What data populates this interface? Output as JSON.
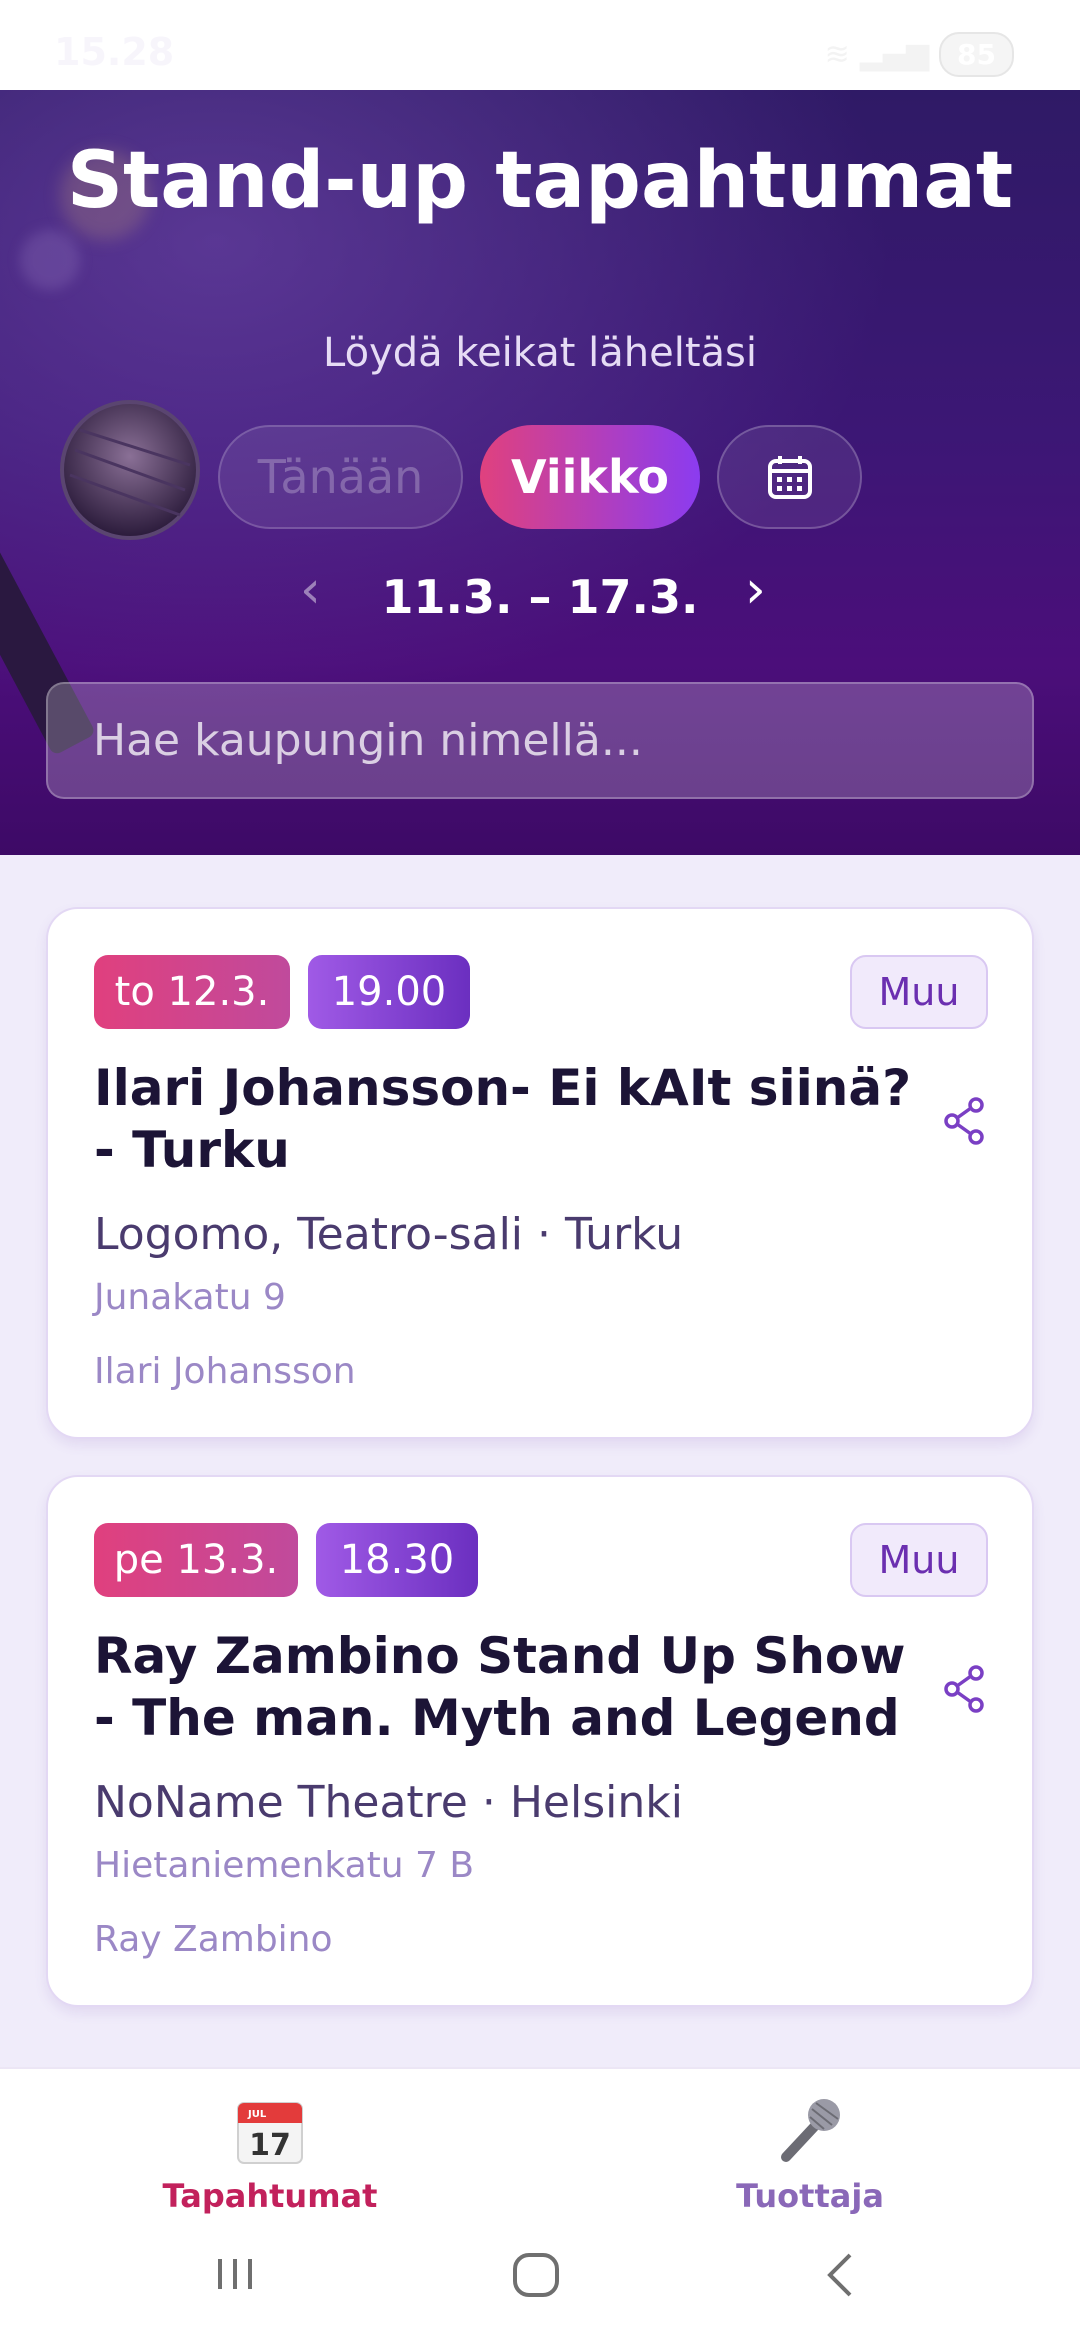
{
  "status_bar": {
    "time": "15.28",
    "battery": "85"
  },
  "hero": {
    "title": "Stand-up tapahtumat",
    "subtitle": "Löydä keikat läheltäsi",
    "segments": {
      "today": "Tänään",
      "week": "Viikko"
    },
    "date_range": "11.3. – 17.3.",
    "search_placeholder": "Hae kaupungin nimellä..."
  },
  "events": [
    {
      "date": "to 12.3.",
      "time": "19.00",
      "category": "Muu",
      "title": "Ilari Johansson- Ei kAIt siinä? - Turku",
      "venue": "Logomo, Teatro-sali · Turku",
      "address": "Junakatu 9",
      "performer": "Ilari Johansson"
    },
    {
      "date": "pe 13.3.",
      "time": "18.30",
      "category": "Muu",
      "title": "Ray Zambino Stand Up Show - The man. Myth and Legend",
      "venue": "NoName Theatre · Helsinki",
      "address": "Hietaniemenkatu 7 B",
      "performer": "Ray Zambino"
    }
  ],
  "bottom_nav": {
    "events_label": "Tapahtumat",
    "events_icon_text": "17",
    "events_icon_month": "JUL",
    "producer_label": "Tuottaja"
  },
  "icons": [
    "calendar-icon",
    "chevron-left-icon",
    "chevron-right-icon",
    "share-icon",
    "microphone-icon",
    "calendar-17-icon"
  ],
  "colors": {
    "accent_pink": "#e0417e",
    "accent_purple": "#8b3cf0",
    "hero_bg": "#3c1775"
  }
}
